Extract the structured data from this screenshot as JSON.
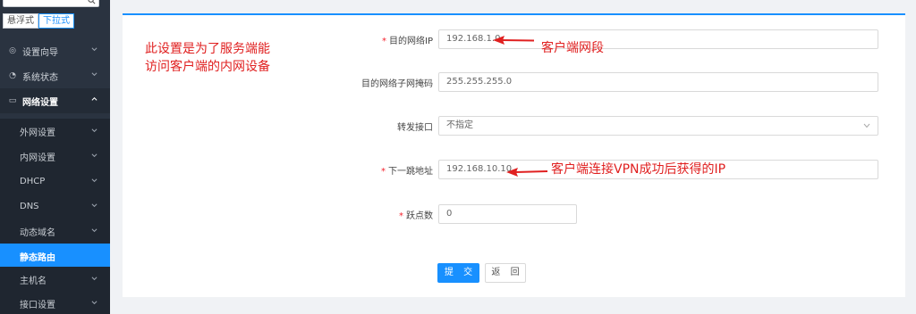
{
  "sidebar": {
    "mode_switch": {
      "hover_label": "悬浮式",
      "dropdown_label": "下拉式"
    },
    "nav": [
      {
        "label": "设置向导"
      },
      {
        "label": "系统状态"
      },
      {
        "label": "网络设置"
      }
    ],
    "sub_items": [
      {
        "label": "外网设置"
      },
      {
        "label": "内网设置"
      },
      {
        "label": "DHCP"
      },
      {
        "label": "DNS"
      },
      {
        "label": "动态域名"
      },
      {
        "label": "静态路由"
      },
      {
        "label": "主机名"
      },
      {
        "label": "接口设置"
      }
    ]
  },
  "annotations": {
    "note_line1": "此设置是为了服务端能",
    "note_line2": "访问客户端的内网设备",
    "dest_ip_note": "客户端网段",
    "next_hop_note": "客户端连接VPN成功后获得的IP",
    "color": "#e02020"
  },
  "form": {
    "dest_ip": {
      "label": "目的网络IP",
      "value": "192.168.1.0",
      "required": true
    },
    "subnet_mask": {
      "label": "目的网络子网掩码",
      "value": "255.255.255.0",
      "required": false
    },
    "interface": {
      "label": "转发接口",
      "value": "不指定",
      "required": false
    },
    "next_hop": {
      "label": "下一跳地址",
      "value": "192.168.10.10",
      "required": true
    },
    "hops": {
      "label": "跃点数",
      "value": "0",
      "required": true
    }
  },
  "buttons": {
    "submit": "提 交",
    "back": "返 回"
  },
  "colors": {
    "accent": "#1890ff",
    "sidebar_bg": "#2a3340",
    "required": "#f5222d"
  }
}
